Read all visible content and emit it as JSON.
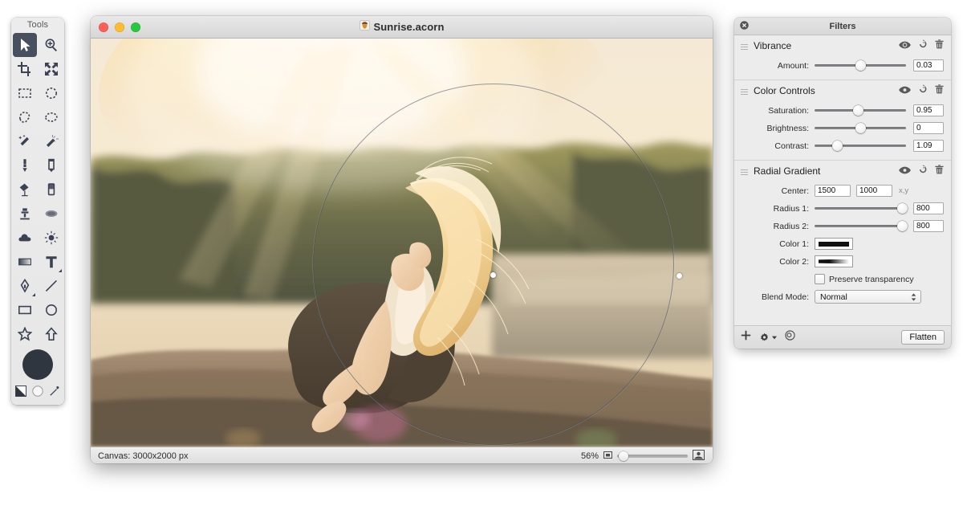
{
  "tools_palette": {
    "title": "Tools",
    "selected_index": 0,
    "items": [
      {
        "name": "move-tool",
        "icon": "arrow-cursor-icon",
        "label": "Move"
      },
      {
        "name": "zoom-tool",
        "icon": "magnifier-icon",
        "label": "Zoom"
      },
      {
        "name": "crop-tool",
        "icon": "crop-icon",
        "label": "Crop"
      },
      {
        "name": "transform-tool",
        "icon": "transform-arrows-icon",
        "label": "Transform"
      },
      {
        "name": "rectangular-select-tool",
        "icon": "marquee-rect-icon",
        "label": "Rectangular Selection"
      },
      {
        "name": "elliptical-select-tool",
        "icon": "marquee-ellipse-icon",
        "label": "Elliptical Selection"
      },
      {
        "name": "polygon-select-tool",
        "icon": "polygon-lasso-icon",
        "label": "Polygonal Selection"
      },
      {
        "name": "freehand-select-tool",
        "icon": "lasso-icon",
        "label": "Freehand Selection"
      },
      {
        "name": "magic-wand-tool",
        "icon": "magic-wand-icon",
        "label": "Magic Wand"
      },
      {
        "name": "instant-alpha-tool",
        "icon": "sparkle-wand-icon",
        "label": "Instant Alpha"
      },
      {
        "name": "brush-tool",
        "icon": "brush-icon",
        "label": "Brush"
      },
      {
        "name": "pencil-tool",
        "icon": "pencil-icon",
        "label": "Pencil"
      },
      {
        "name": "paint-bucket-tool",
        "icon": "paint-bucket-icon",
        "label": "Paint Bucket"
      },
      {
        "name": "eraser-tool",
        "icon": "eraser-icon",
        "label": "Eraser"
      },
      {
        "name": "clone-stamp-tool",
        "icon": "clone-stamp-icon",
        "label": "Clone Stamp"
      },
      {
        "name": "smudge-tool",
        "icon": "smudge-icon",
        "label": "Smudge"
      },
      {
        "name": "blur-tool",
        "icon": "cloud-blur-icon",
        "label": "Blur"
      },
      {
        "name": "dodge-tool",
        "icon": "sun-dodge-icon",
        "label": "Dodge"
      },
      {
        "name": "gradient-tool",
        "icon": "gradient-icon",
        "label": "Gradient"
      },
      {
        "name": "text-tool",
        "icon": "text-t-icon",
        "label": "Text"
      },
      {
        "name": "bezier-pen-tool",
        "icon": "pen-nib-icon",
        "label": "Bezier Pen"
      },
      {
        "name": "line-tool",
        "icon": "line-icon",
        "label": "Line"
      },
      {
        "name": "rectangle-shape-tool",
        "icon": "rectangle-icon",
        "label": "Rectangle"
      },
      {
        "name": "ellipse-shape-tool",
        "icon": "circle-icon",
        "label": "Ellipse"
      },
      {
        "name": "star-shape-tool",
        "icon": "star-icon",
        "label": "Star"
      },
      {
        "name": "arrow-shape-tool",
        "icon": "arrow-shape-icon",
        "label": "Arrow"
      }
    ],
    "foreground_color": "#2f3640",
    "bottom_row": [
      {
        "name": "swap-colors-control",
        "icon": "swap-colors-icon"
      },
      {
        "name": "default-colors-control",
        "icon": "default-colors-icon"
      },
      {
        "name": "eyedropper-tool",
        "icon": "eyedropper-icon"
      }
    ]
  },
  "document_window": {
    "title": "Sunrise.acorn",
    "app_icon": "acorn-icon",
    "traffic_lights": [
      {
        "name": "close-button",
        "color": "#ff5f57"
      },
      {
        "name": "minimize-button",
        "color": "#febc2e"
      },
      {
        "name": "zoom-button",
        "color": "#28c840"
      }
    ],
    "status_bar": {
      "canvas_label": "Canvas: 3000x2000 px",
      "zoom_percent": "56%",
      "zoom_min_icon": "small-image-icon",
      "zoom_max_icon": "large-image-icon",
      "zoom_slider_value": 8
    },
    "overlay": {
      "shape": "radial-gradient-circle",
      "center_handle": "center-handle-dot",
      "radius_handle": "radius-handle-dot"
    }
  },
  "filters_panel": {
    "title": "Filters",
    "close_icon": "close-circle-icon",
    "group_icons": [
      {
        "name": "visibility-toggle",
        "icon": "eye-icon"
      },
      {
        "name": "reset-filter-button",
        "icon": "reset-arrow-icon"
      },
      {
        "name": "delete-filter-button",
        "icon": "trash-icon"
      }
    ],
    "groups": [
      {
        "name": "Vibrance",
        "rows": [
          {
            "type": "slider",
            "label": "Amount:",
            "value": "0.03",
            "thumb_percent": 50
          }
        ]
      },
      {
        "name": "Color Controls",
        "rows": [
          {
            "type": "slider",
            "label": "Saturation:",
            "value": "0.95",
            "thumb_percent": 48
          },
          {
            "type": "slider",
            "label": "Brightness:",
            "value": "0",
            "thumb_percent": 50
          },
          {
            "type": "slider",
            "label": "Contrast:",
            "value": "1.09",
            "thumb_percent": 25
          }
        ]
      },
      {
        "name": "Radial Gradient",
        "rows": [
          {
            "type": "xy",
            "label": "Center:",
            "x": "1500",
            "y": "1000",
            "suffix": "x,y"
          },
          {
            "type": "slider",
            "label": "Radius 1:",
            "value": "800",
            "thumb_percent": 96
          },
          {
            "type": "slider",
            "label": "Radius 2:",
            "value": "800",
            "thumb_percent": 96
          },
          {
            "type": "color",
            "label": "Color 1:",
            "swatch": "solid-black"
          },
          {
            "type": "color",
            "label": "Color 2:",
            "swatch": "black-to-white-wedge"
          },
          {
            "type": "checkbox",
            "label": "Preserve transparency",
            "checked": false
          },
          {
            "type": "select",
            "label": "Blend Mode:",
            "value": "Normal"
          }
        ]
      }
    ],
    "footer": {
      "add_icon": "plus-icon",
      "settings_icon": "gear-dropdown-icon",
      "presets_icon": "target-preset-icon",
      "flatten_label": "Flatten"
    }
  }
}
